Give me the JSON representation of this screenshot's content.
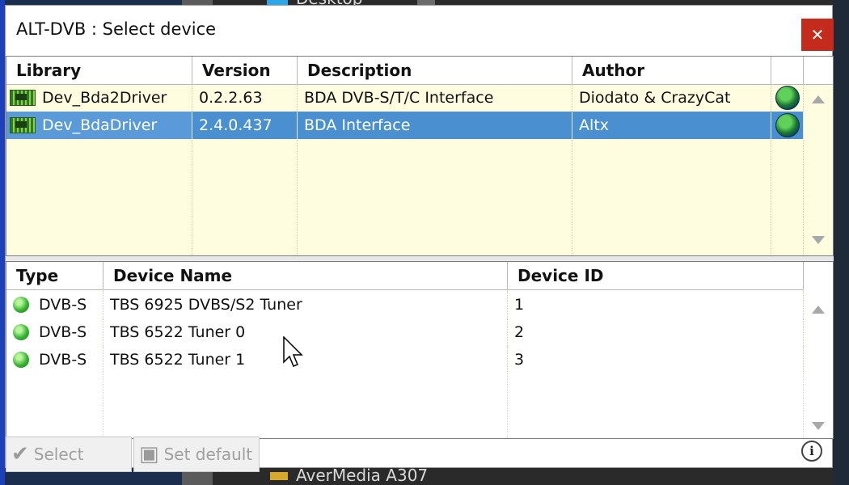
{
  "window": {
    "title": "ALT-DVB : Select device",
    "close_glyph": "✕"
  },
  "background": {
    "top_text": "Desktop",
    "bottom_text": "AverMedia A307"
  },
  "library_table": {
    "columns": [
      "Library",
      "Version",
      "Description",
      "Author"
    ],
    "rows": [
      {
        "library": "Dev_Bda2Driver",
        "version": "0.2.2.63",
        "description": "BDA DVB-S/T/C Interface",
        "author": "Diodato & CrazyCat",
        "icon": "chip-icon",
        "status_icon": "globe-icon",
        "selected": false
      },
      {
        "library": "Dev_BdaDriver",
        "version": "2.4.0.437",
        "description": "BDA Interface",
        "author": "Altx",
        "icon": "chip-icon",
        "status_icon": "globe-icon",
        "selected": true
      }
    ]
  },
  "device_table": {
    "columns": [
      "Type",
      "Device Name",
      "Device ID"
    ],
    "rows": [
      {
        "type": "DVB-S",
        "name": "TBS 6925 DVBS/S2 Tuner",
        "id": "1",
        "icon": "green-dot-icon"
      },
      {
        "type": "DVB-S",
        "name": "TBS 6522 Tuner 0",
        "id": "2",
        "icon": "green-dot-icon"
      },
      {
        "type": "DVB-S",
        "name": "TBS 6522 Tuner 1",
        "id": "3",
        "icon": "green-dot-icon"
      }
    ]
  },
  "toolbar": {
    "select_label": "Select",
    "set_default_label": "Set default",
    "info_glyph": "i"
  },
  "colors": {
    "selection": "#4a90d0",
    "top_pane_bg": "#fefde0",
    "close_bg": "#c42b1c"
  }
}
